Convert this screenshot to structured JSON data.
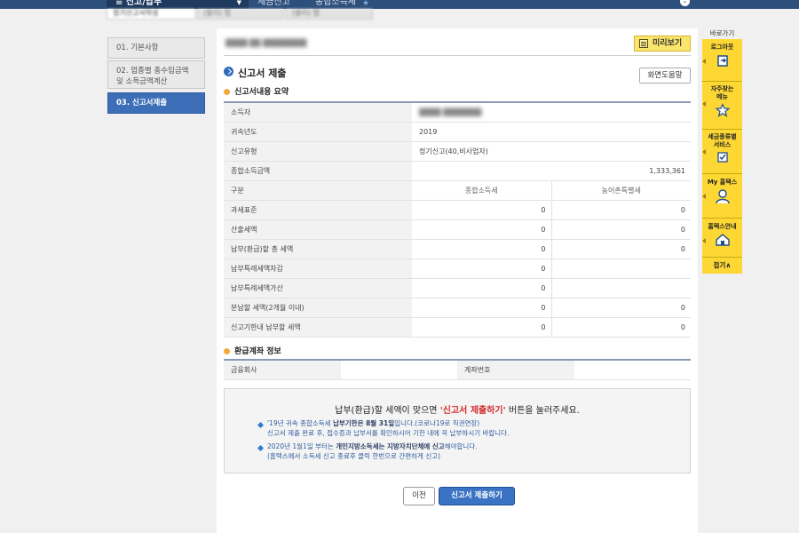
{
  "topbar": {
    "menu_label": "≡ 신고/납부",
    "crumb1": "세금신고",
    "crumb2": "종합소득세"
  },
  "subtabs": [
    "정기신고서작성",
    "(블러) 탭",
    "(블러) 탭"
  ],
  "steps": [
    {
      "label": "01. 기본사항",
      "active": false
    },
    {
      "label": "02. 업종별 총수입금액 및 소득금액계산",
      "active": false
    },
    {
      "label": "03. 신고서제출",
      "active": true
    }
  ],
  "main": {
    "preview_label": "미리보기",
    "page_title": "신고서 제출",
    "help_label": "화면도움말",
    "summary_title": "신고서내용 요약",
    "refund_title": "환급계좌 정보"
  },
  "summary": {
    "owner_label": "소득자",
    "year_label": "귀속년도",
    "year_value": "2019",
    "type_label": "신고유형",
    "type_value": "정기신고(40,비사업자)",
    "total_label": "종합소득금액",
    "total_value": "1,333,361",
    "col_label": "구분",
    "col1": "종합소득세",
    "col2": "농어촌특별세",
    "rows": [
      {
        "label": "과세표준",
        "v1": "0",
        "v2": "0"
      },
      {
        "label": "산출세액",
        "v1": "0",
        "v2": "0"
      },
      {
        "label": "납부(환급)할 총 세액",
        "v1": "0",
        "v2": "0"
      },
      {
        "label": "납부특례세액차감",
        "v1": "0",
        "v2": ""
      },
      {
        "label": "납부특례세액가산",
        "v1": "0",
        "v2": ""
      },
      {
        "label": "분납할 세액(2개월 이내)",
        "v1": "0",
        "v2": "0"
      },
      {
        "label": "신고기한내 납부할 세액",
        "v1": "0",
        "v2": "0"
      }
    ]
  },
  "refund": {
    "bank_label": "금융회사",
    "account_label": "계좌번호"
  },
  "notice": {
    "headline_pre": "납부(환급)할 세액이 맞으면 ",
    "headline_red": "'신고서 제출하기'",
    "headline_post": " 버튼을 눌러주세요.",
    "line1a": "'19년 귀속 종합소득세 ",
    "line1b": "납부기한은 8월 31일",
    "line1c": "입니다.(코로나19로 직권연장)",
    "line2": "신고서 제출 완료 후, 접수증과 납부서를 확인하시어 기한 내에 꼭 납부하시기 바랍니다.",
    "line3a": "2020년 1월1일 부터는 ",
    "line3b": "개인지방소득세는 지방자치단체에 신고",
    "line3c": "해야합니다.",
    "line4": "(홈택스에서 소득세 신고 종료후 클릭 한번으로 간편하게 신고)"
  },
  "buttons": {
    "prev": "이전",
    "submit": "신고서 제출하기"
  },
  "quick": {
    "title": "바로가기",
    "items": [
      "로그아웃",
      "자주찾는 메뉴",
      "세금종류별 서비스",
      "My 홈택스",
      "홈택스안내"
    ],
    "close": "접기∧"
  },
  "colors": {
    "topbar": "#2d4f7c",
    "accent_blue": "#3a72c4",
    "quick_yellow": "#fdd835",
    "notice_red": "#d32d2d"
  }
}
